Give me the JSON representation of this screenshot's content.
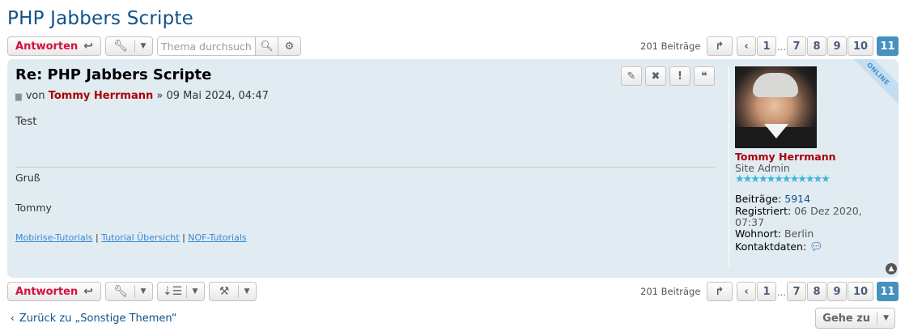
{
  "topic": {
    "title": "PHP Jabbers Scripte"
  },
  "toolbar": {
    "reply_label": "Antworten",
    "reply_icon": "reply-arrow-icon",
    "tools_icon": "wrench-icon",
    "sort_icon": "sort-icon",
    "moderation_icon": "gavel-icon",
    "caret_icon": "caret-down-icon"
  },
  "search": {
    "placeholder": "Thema durchsuchen…",
    "value": ""
  },
  "pagination": {
    "count_label": "201 Beiträge",
    "jump_icon": "share-arrow-icon",
    "prev_icon": "chevron-left-icon",
    "ellipsis": "…",
    "pages": [
      "1",
      "7",
      "8",
      "9",
      "10",
      "11"
    ],
    "active_page": "11"
  },
  "post": {
    "title": "Re: PHP Jabbers Scripte",
    "byline_prefix": "von",
    "author": "Tommy Herrmann",
    "date": "» 09 Mai 2024, 04:47",
    "content": "Test",
    "signature": {
      "greeting": "Gruß",
      "name": "Tommy",
      "links": [
        "Mobirise-Tutorials",
        "Tutorial Übersicht",
        "NOF-Tutorials"
      ],
      "separator": "|"
    },
    "action_icons": [
      "pencil-icon",
      "delete-icon",
      "report-icon",
      "quote-icon"
    ],
    "online_label": "ONLINE"
  },
  "profile": {
    "name": "Tommy Herrmann",
    "rank": "Site Admin",
    "stars": "★★★★★★★★★★★★",
    "posts_label": "Beiträge:",
    "posts_value": "5914",
    "registered_label": "Registriert:",
    "registered_value_1": "06 Dez 2020,",
    "registered_value_2": "07:37",
    "location_label": "Wohnort:",
    "location_value": "Berlin",
    "contact_label": "Kontaktdaten:"
  },
  "footer": {
    "back_label": "Zurück zu „Sonstige Themen“",
    "goto_label": "Gehe zu"
  },
  "colors": {
    "title": "#105289",
    "reply": "#d31141",
    "author": "#aa0000",
    "post_bg": "#e1ebf2",
    "active_page": "#4692bf"
  }
}
